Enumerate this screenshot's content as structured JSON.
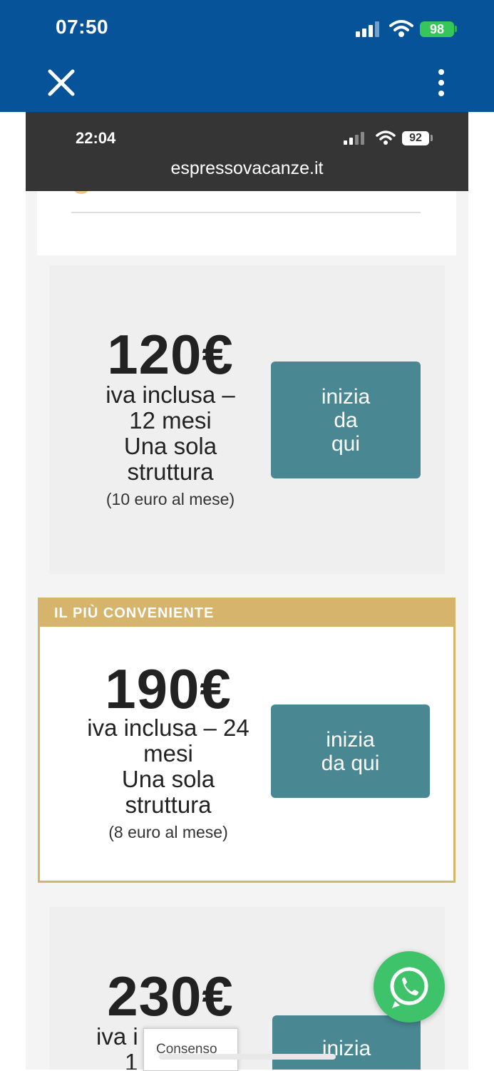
{
  "outer_status": {
    "time": "07:50",
    "battery": "98"
  },
  "inner_status": {
    "time": "22:04",
    "battery": "92",
    "url": "espressovacanze.it"
  },
  "colors": {
    "header_blue": "#06539a",
    "cta_teal": "#498792",
    "gold": "#d6b46c",
    "whatsapp_green": "#3ec36b"
  },
  "plans": [
    {
      "price": "120€",
      "desc": [
        "iva inclusa –",
        "12 mesi",
        "Una sola",
        "struttura"
      ],
      "sub": "(10 euro al mese)",
      "cta": [
        "inizia",
        "da",
        "qui"
      ]
    },
    {
      "badge": "IL PIÙ CONVENIENTE",
      "price": "190€",
      "desc": [
        "iva inclusa – 24",
        "mesi",
        "Una sola",
        "struttura"
      ],
      "sub": "(8 euro al mese)",
      "cta": [
        "inizia",
        "da qui"
      ]
    },
    {
      "price": "230€",
      "desc": [
        "iva i",
        "1"
      ],
      "cta": [
        "inizia"
      ]
    }
  ],
  "consent_label": "Consenso",
  "icons": {
    "close": "close-icon",
    "more": "more-vertical-icon",
    "whatsapp": "whatsapp-icon"
  }
}
